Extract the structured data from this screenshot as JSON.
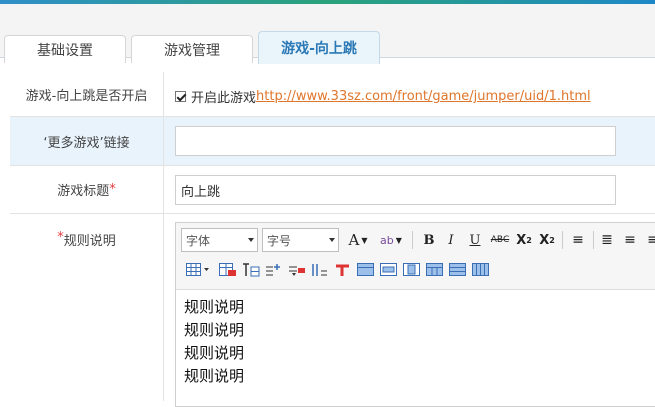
{
  "tabs": [
    {
      "label": "基础设置"
    },
    {
      "label": "游戏管理"
    },
    {
      "label": "游戏-向上跳"
    }
  ],
  "form": {
    "enable_label": "游戏-向上跳是否开启",
    "enable_checkbox_text": "开启此游戏",
    "enable_link": "http://www.33sz.com/front/game/jumper/uid/1.html",
    "more_games_label": "‘更多游戏’链接",
    "more_games_value": "",
    "title_label": "游戏标题",
    "title_required_mark": "*",
    "title_value": "向上跳",
    "rules_required_mark": "*",
    "rules_label": "规则说明"
  },
  "editor": {
    "font_select": "字体",
    "size_select": "字号",
    "content_lines": [
      "规则说明",
      "规则说明",
      "规则说明",
      "规则说明"
    ]
  },
  "colors": {
    "accent": "#2a79b6",
    "link": "#e0762b",
    "required": "#e03c3c",
    "highlight_row": "#e9f3fc"
  }
}
